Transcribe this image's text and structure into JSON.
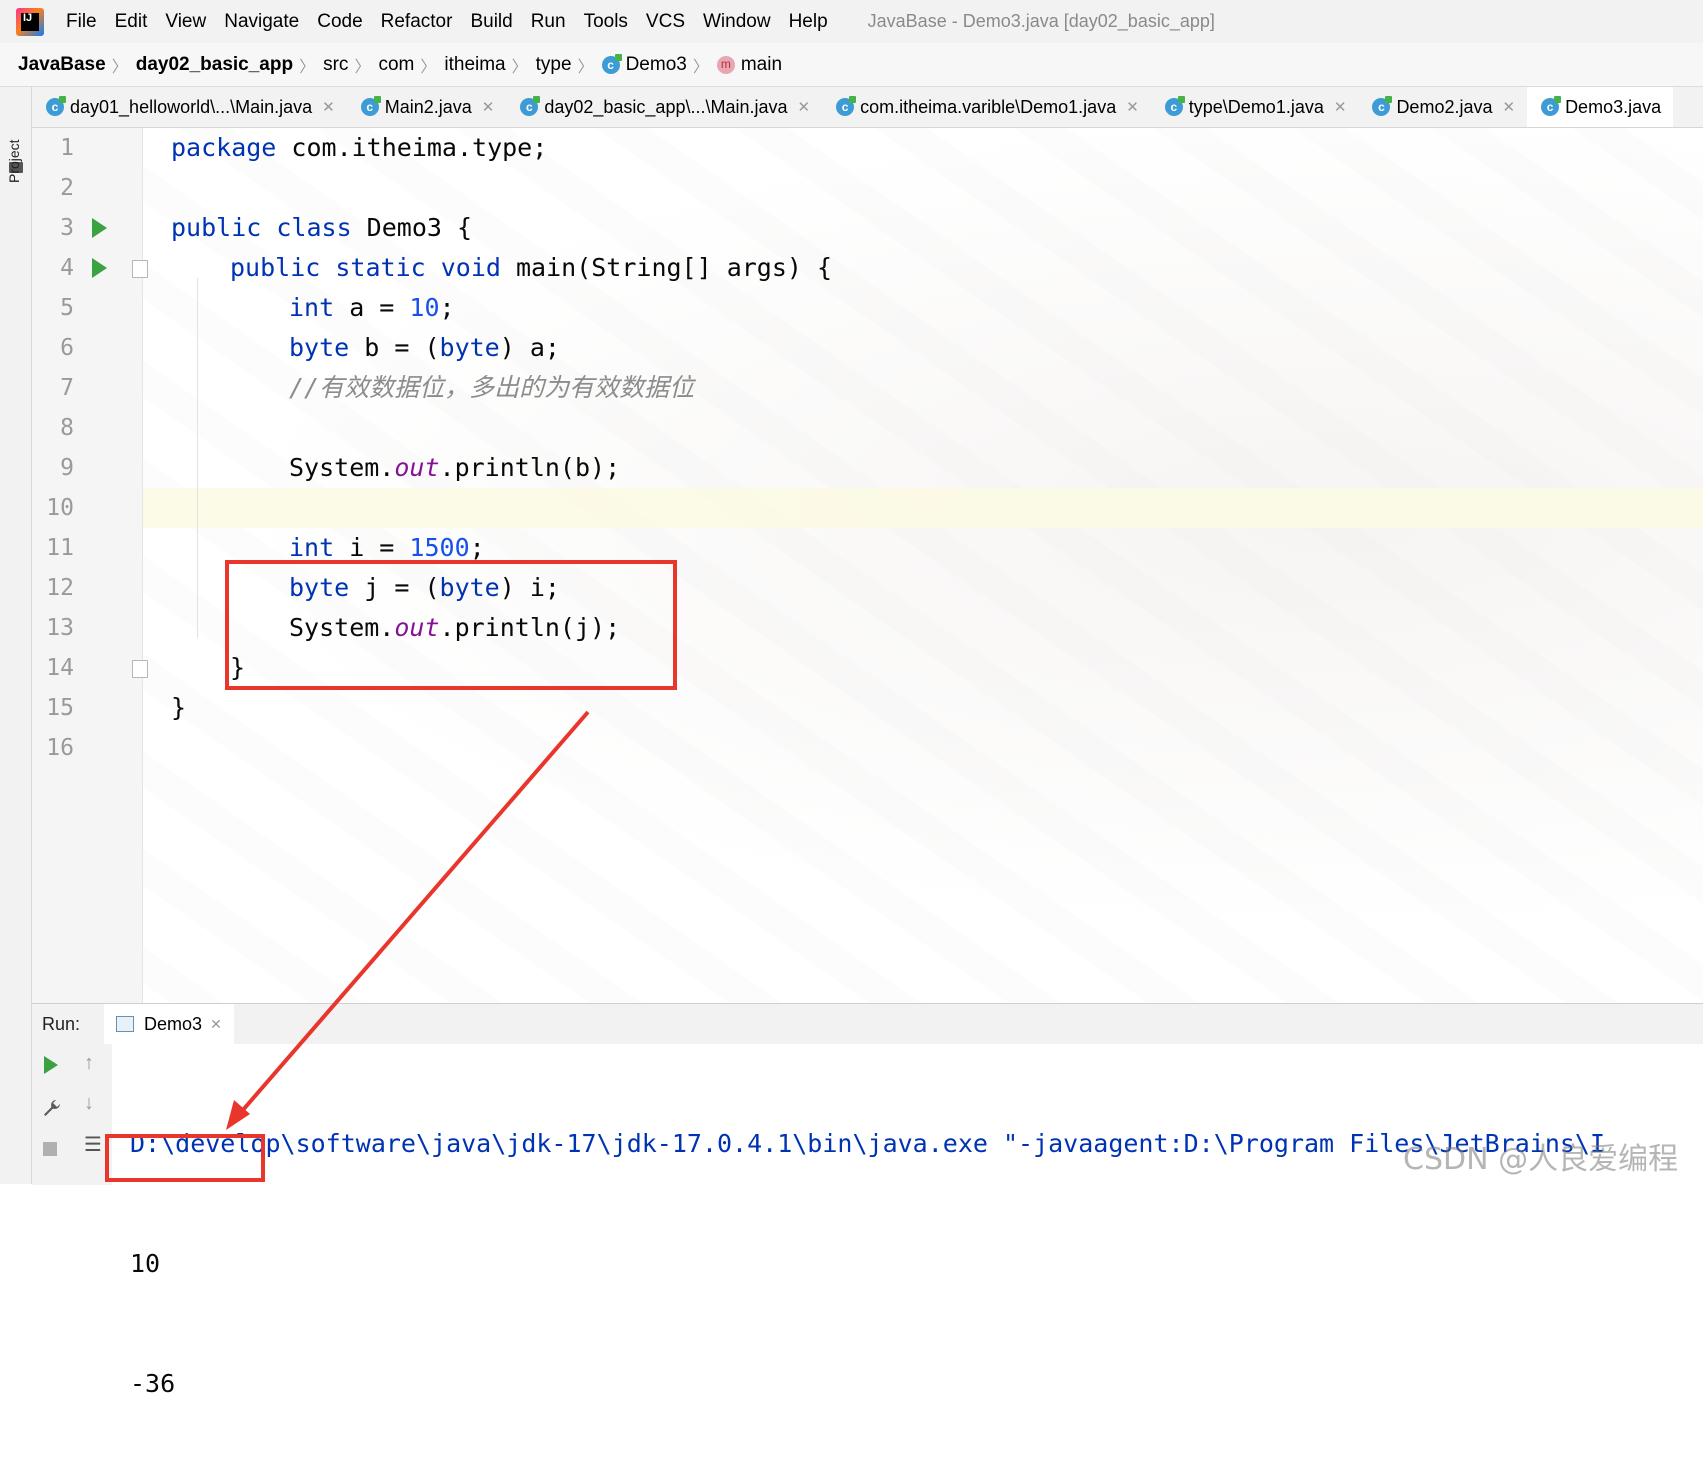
{
  "menu": {
    "items": [
      "File",
      "Edit",
      "View",
      "Navigate",
      "Code",
      "Refactor",
      "Build",
      "Run",
      "Tools",
      "VCS",
      "Window",
      "Help"
    ],
    "window_title": "JavaBase - Demo3.java [day02_basic_app]"
  },
  "breadcrumb": {
    "items": [
      "JavaBase",
      "day02_basic_app",
      "src",
      "com",
      "itheima",
      "type",
      "Demo3",
      "main"
    ]
  },
  "sidebar": {
    "project_label": "Project"
  },
  "tabs": [
    {
      "label": "day01_helloworld\\...\\Main.java"
    },
    {
      "label": "Main2.java"
    },
    {
      "label": "day02_basic_app\\...\\Main.java"
    },
    {
      "label": "com.itheima.varible\\Demo1.java"
    },
    {
      "label": "type\\Demo1.java"
    },
    {
      "label": "Demo2.java"
    },
    {
      "label": "Demo3.java"
    }
  ],
  "editor": {
    "line_numbers": [
      "1",
      "2",
      "3",
      "4",
      "5",
      "6",
      "7",
      "8",
      "9",
      "10",
      "11",
      "12",
      "13",
      "14",
      "15",
      "16"
    ],
    "current_line": 10,
    "code": {
      "l1_kw": "package",
      "l1_rest": " com.itheima.type;",
      "l3_kw": "public class",
      "l3_rest": " Demo3 {",
      "l4_kw": "public static void",
      "l4_rest": " main(String[] args) {",
      "l5_kw": "int",
      "l5_mid": " a = ",
      "l5_num": "10",
      "l5_end": ";",
      "l6_kw": "byte",
      "l6_mid": " b = (",
      "l6_kw2": "byte",
      "l6_end": ") a;",
      "l7_comment": "//有效数据位，多出的为有效数据位",
      "l9_a": "System.",
      "l9_fld": "out",
      "l9_b": ".println(b);",
      "l11_kw": "int",
      "l11_mid": " i = ",
      "l11_num": "1500",
      "l11_end": ";",
      "l12_kw": "byte",
      "l12_mid": " j = (",
      "l12_kw2": "byte",
      "l12_end": ") i;",
      "l13_a": "System.",
      "l13_fld": "out",
      "l13_b": ".println(j);",
      "l14": "}",
      "l15": "}"
    }
  },
  "run_panel": {
    "label": "Run:",
    "tab_label": "Demo3",
    "console_lines": [
      "D:\\develop\\software\\java\\jdk-17\\jdk-17.0.4.1\\bin\\java.exe \"-javaagent:D:\\Program Files\\JetBrains\\I",
      "10",
      "-36"
    ]
  },
  "watermark": "CSDN @人良爱编程",
  "colors": {
    "annotation_red": "#e8362d",
    "keyword_blue": "#0033b3",
    "number_blue": "#1750eb",
    "field_purple": "#871094",
    "run_green": "#3aa240"
  }
}
